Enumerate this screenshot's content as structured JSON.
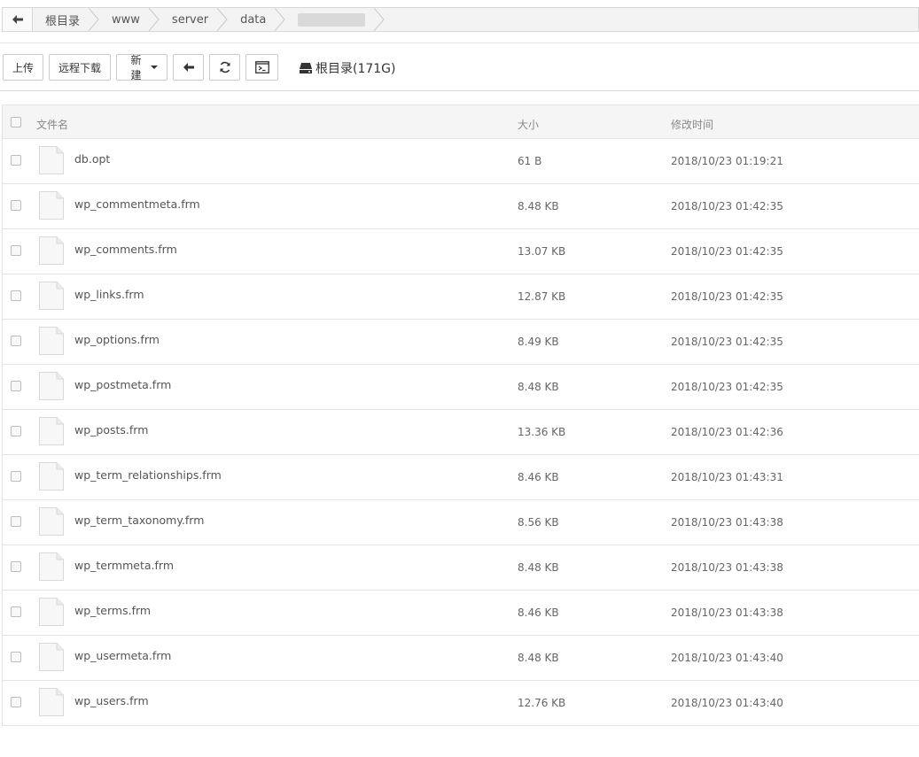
{
  "breadcrumb": {
    "items": [
      "根目录",
      "www",
      "server",
      "data",
      ""
    ]
  },
  "toolbar": {
    "upload_label": "上传",
    "remote_download_label": "远程下载",
    "new_label": "新建",
    "disk_label": "根目录(171G)"
  },
  "table": {
    "headers": {
      "name": "文件名",
      "size": "大小",
      "modified": "修改时间"
    },
    "rows": [
      {
        "name": "db.opt",
        "size": "61 B",
        "modified": "2018/10/23 01:19:21"
      },
      {
        "name": "wp_commentmeta.frm",
        "size": "8.48 KB",
        "modified": "2018/10/23 01:42:35"
      },
      {
        "name": "wp_comments.frm",
        "size": "13.07 KB",
        "modified": "2018/10/23 01:42:35"
      },
      {
        "name": "wp_links.frm",
        "size": "12.87 KB",
        "modified": "2018/10/23 01:42:35"
      },
      {
        "name": "wp_options.frm",
        "size": "8.49 KB",
        "modified": "2018/10/23 01:42:35"
      },
      {
        "name": "wp_postmeta.frm",
        "size": "8.48 KB",
        "modified": "2018/10/23 01:42:35"
      },
      {
        "name": "wp_posts.frm",
        "size": "13.36 KB",
        "modified": "2018/10/23 01:42:36"
      },
      {
        "name": "wp_term_relationships.frm",
        "size": "8.46 KB",
        "modified": "2018/10/23 01:43:31"
      },
      {
        "name": "wp_term_taxonomy.frm",
        "size": "8.56 KB",
        "modified": "2018/10/23 01:43:38"
      },
      {
        "name": "wp_termmeta.frm",
        "size": "8.48 KB",
        "modified": "2018/10/23 01:43:38"
      },
      {
        "name": "wp_terms.frm",
        "size": "8.46 KB",
        "modified": "2018/10/23 01:43:38"
      },
      {
        "name": "wp_usermeta.frm",
        "size": "8.48 KB",
        "modified": "2018/10/23 01:43:40"
      },
      {
        "name": "wp_users.frm",
        "size": "12.76 KB",
        "modified": "2018/10/23 01:43:40"
      }
    ]
  }
}
